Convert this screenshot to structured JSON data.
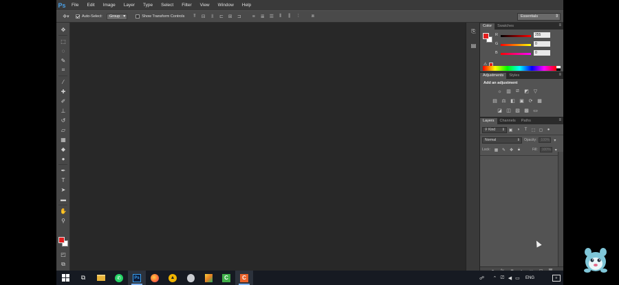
{
  "app": {
    "logo": "Ps"
  },
  "menu": [
    "File",
    "Edit",
    "Image",
    "Layer",
    "Type",
    "Select",
    "Filter",
    "View",
    "Window",
    "Help"
  ],
  "options": {
    "auto_select_label": "Auto-Select:",
    "auto_select_value": "Group",
    "show_transform_label": "Show Transform Controls",
    "workspace": "Essentials"
  },
  "color_panel": {
    "tabs": [
      "Color",
      "Swatches"
    ],
    "sliders": [
      {
        "label": "R",
        "value": "255"
      },
      {
        "label": "G",
        "value": "0"
      },
      {
        "label": "B",
        "value": "0"
      }
    ],
    "fg": "#e21e1e",
    "bg": "#ffffff"
  },
  "adjustments_panel": {
    "tabs": [
      "Adjustments",
      "Styles"
    ],
    "title": "Add an adjustment"
  },
  "layers_panel": {
    "tabs": [
      "Layers",
      "Channels",
      "Paths"
    ],
    "kind": "Kind",
    "blend_mode": "Normal",
    "opacity_label": "Opacity:",
    "opacity_value": "100%",
    "lock_label": "Lock:",
    "fill_label": "Fill:",
    "fill_value": "100%"
  },
  "taskbar": {
    "language": "ENG"
  }
}
